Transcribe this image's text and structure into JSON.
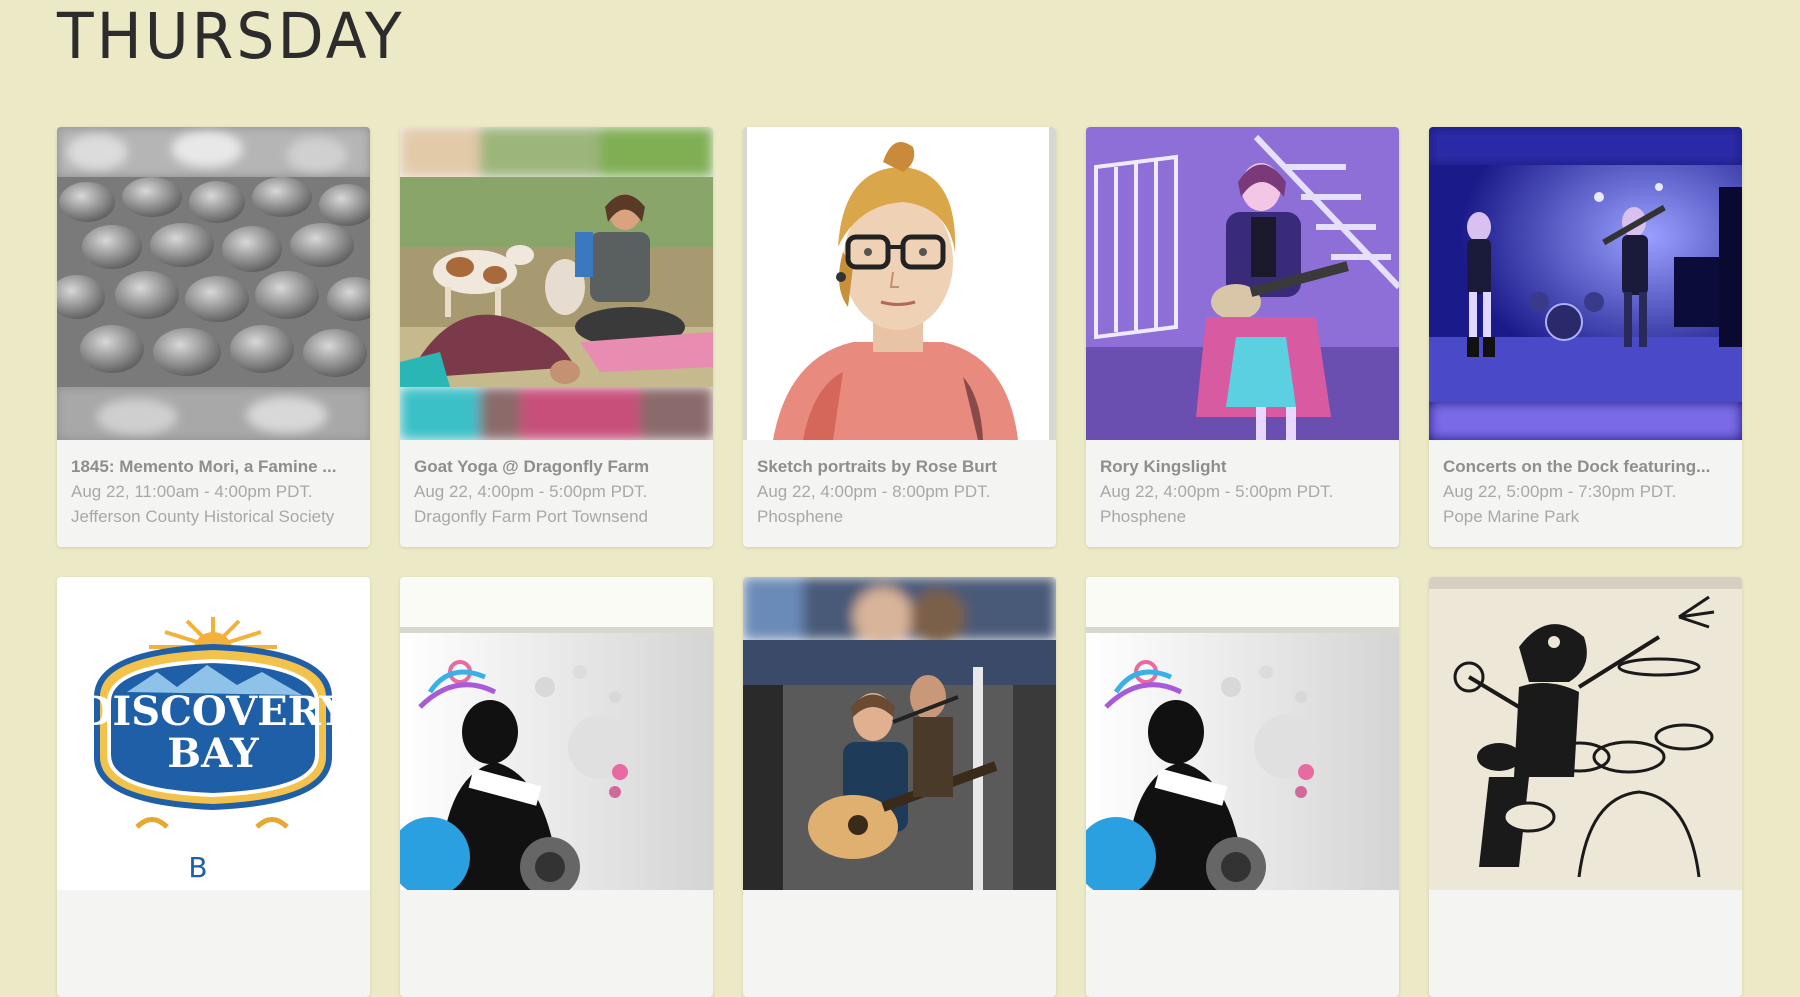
{
  "page": {
    "day": "THURSDAY"
  },
  "events": [
    {
      "title": "1845: Memento Mori, a Famine ...",
      "time": "Aug 22, 11:00am - 4:00pm PDT.",
      "venue": "Jefferson County Historical Society",
      "image": "grey-potatoes-photo"
    },
    {
      "title": "Goat Yoga @ Dragonfly Farm",
      "time": "Aug 22, 4:00pm - 5:00pm PDT.",
      "venue": "Dragonfly Farm Port Townsend",
      "image": "goat-yoga-photo"
    },
    {
      "title": "Sketch portraits by Rose Burt",
      "time": "Aug 22, 4:00pm - 8:00pm PDT.",
      "venue": "Phosphene",
      "image": "watercolor-portrait"
    },
    {
      "title": "Rory Kingslight",
      "time": "Aug 22, 4:00pm - 5:00pm PDT.",
      "venue": "Phosphene",
      "image": "ukulele-player-photo"
    },
    {
      "title": "Concerts on the Dock featuring...",
      "time": "Aug 22, 5:00pm - 7:30pm PDT.",
      "venue": "Pope Marine Park",
      "image": "concert-stage-photo"
    },
    {
      "title": "",
      "time": "",
      "venue": "",
      "image": "discovery-bay-logo",
      "logo_text_1": "DISCOVERY",
      "logo_text_2": "BAY"
    },
    {
      "title": "",
      "time": "",
      "venue": "",
      "image": "dj-turntable-graphic"
    },
    {
      "title": "",
      "time": "",
      "venue": "",
      "image": "guitar-singer-photo"
    },
    {
      "title": "",
      "time": "",
      "venue": "",
      "image": "dj-turntable-graphic"
    },
    {
      "title": "",
      "time": "",
      "venue": "",
      "image": "drummer-illustration"
    }
  ],
  "colors": {
    "background": "#eceac6",
    "card": "#f4f4f2",
    "title": "#8e8e8e",
    "meta": "#a8a8a8"
  }
}
